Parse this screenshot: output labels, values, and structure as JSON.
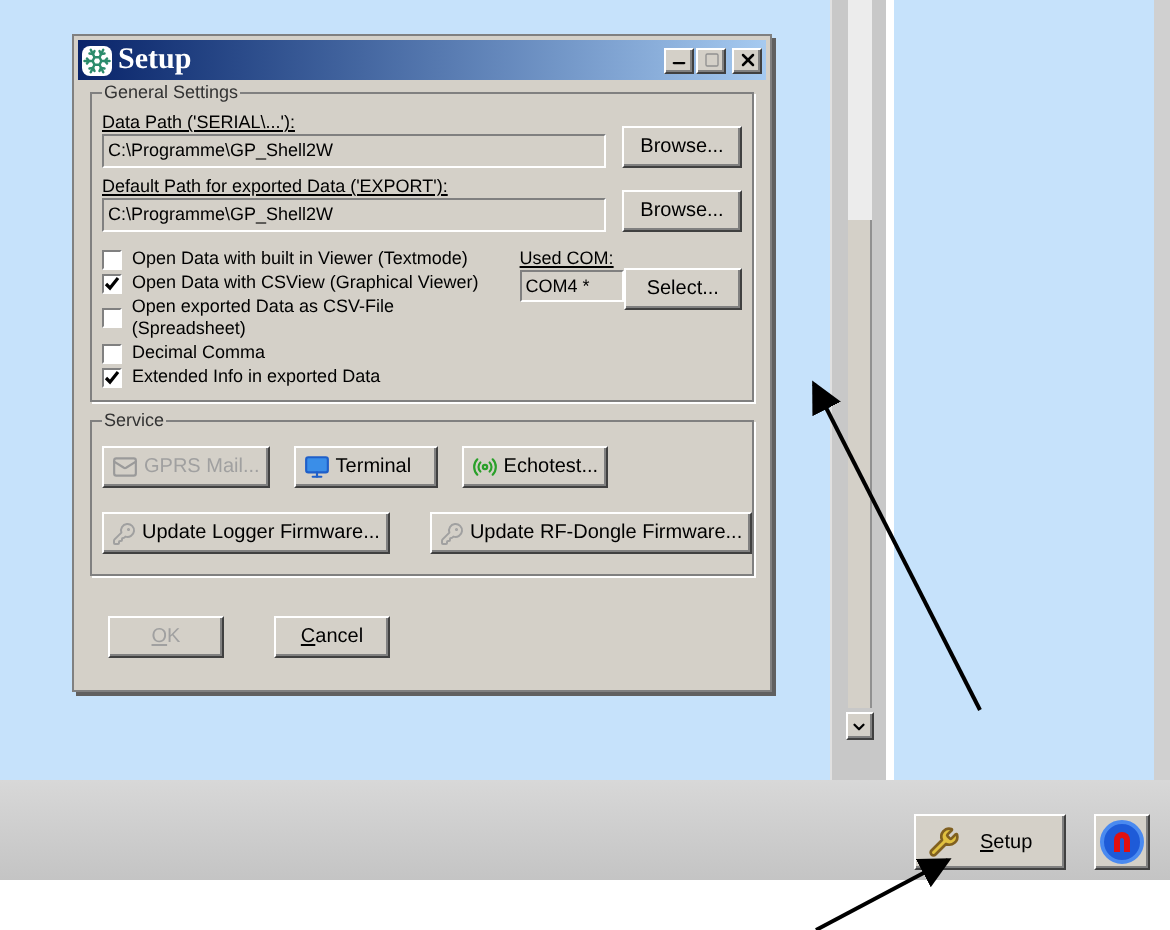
{
  "dialog": {
    "title": "Setup",
    "general_settings": {
      "title": "General Settings",
      "paths": [
        {
          "label": "Data Path ('SERIAL\\...'):",
          "value": "C:\\Programme\\GP_Shell2W",
          "button": "Browse..."
        },
        {
          "label": "Default Path for exported Data ('EXPORT'):",
          "value": "C:\\Programme\\GP_Shell2W",
          "button": "Browse..."
        }
      ],
      "options": [
        {
          "label": "Open Data with built in Viewer (Textmode)",
          "checked": false
        },
        {
          "label": "Open Data with CSView (Graphical Viewer)",
          "checked": true
        },
        {
          "label": "Open exported Data as CSV-File (Spreadsheet)",
          "checked": false
        },
        {
          "label": "Decimal Comma",
          "checked": false
        },
        {
          "label": "Extended Info in exported Data",
          "checked": true
        }
      ],
      "used_com": {
        "label": "Used COM:",
        "value": "COM4 *"
      },
      "select_button": "Select..."
    },
    "service": {
      "title": "Service",
      "row_1": [
        {
          "label": "GPRS Mail...",
          "kind": "mail",
          "disabled": true
        },
        {
          "label": "Terminal",
          "kind": "terminal",
          "disabled": false
        },
        {
          "label": "Echotest...",
          "kind": "echo",
          "disabled": false
        }
      ],
      "row_2": [
        {
          "label": "Update Logger Firmware...",
          "kind": "key",
          "disabled": false
        },
        {
          "label": "Update RF-Dongle Firmware...",
          "kind": "key",
          "disabled": false
        }
      ]
    },
    "buttons": [
      {
        "label": "OK",
        "disabled": true
      },
      {
        "label": "Cancel",
        "disabled": false
      }
    ]
  },
  "toolbar": {
    "setup_button": "Setup"
  }
}
